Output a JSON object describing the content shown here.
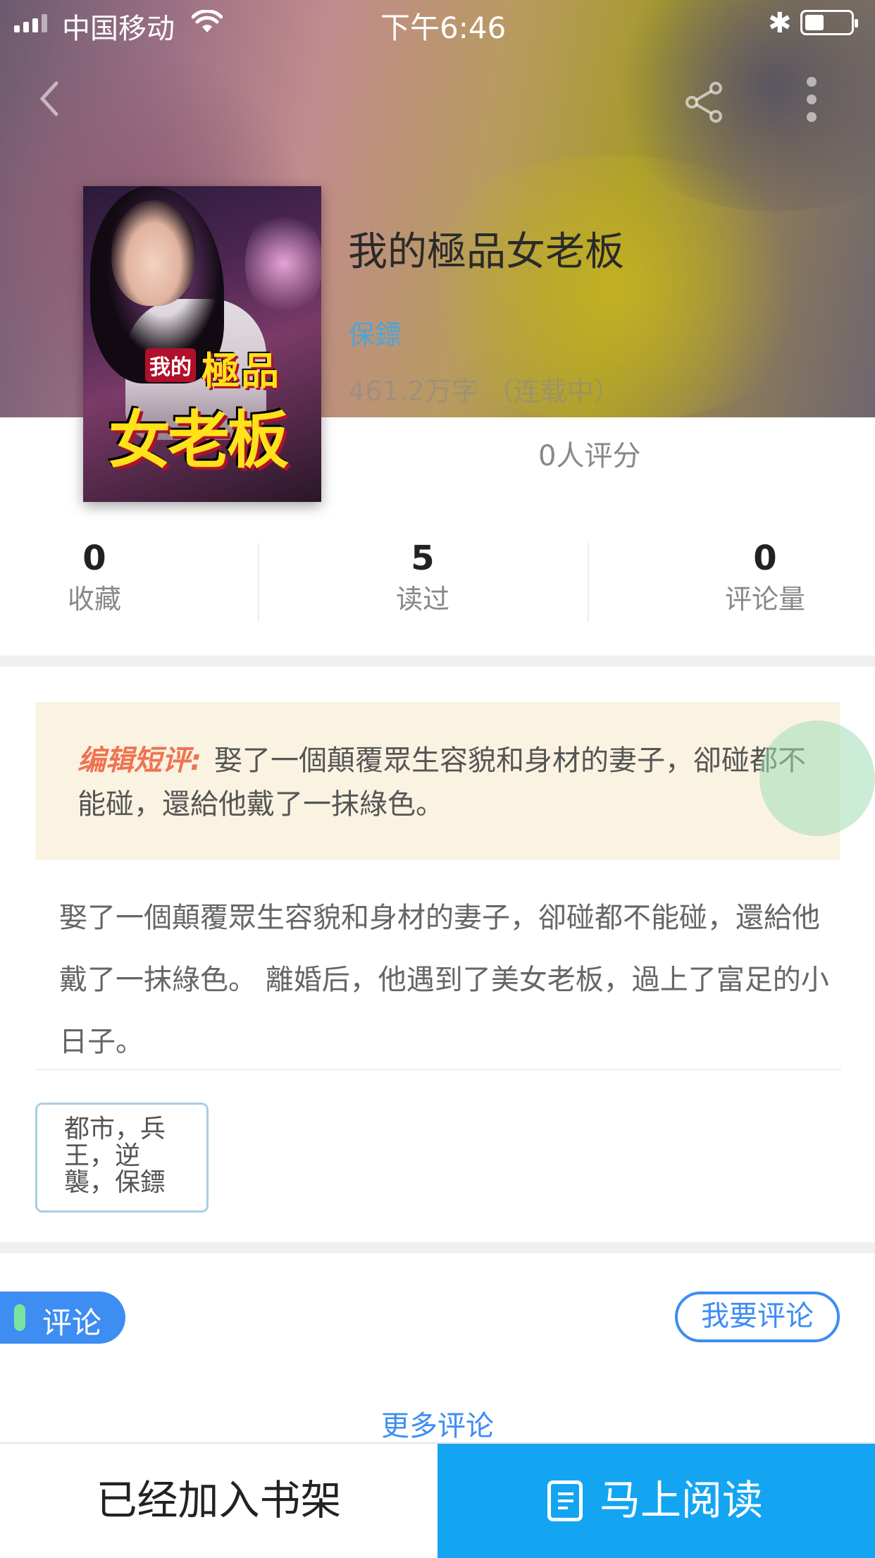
{
  "status_bar": {
    "carrier": "中国移动",
    "time": "下午6:46"
  },
  "book": {
    "title": "我的極品女老板",
    "author": "保鏢",
    "meta": "461.2万字 （连载中）",
    "rating_text": "0人评分",
    "cover": {
      "text_small": "我的",
      "text_mid": "極品",
      "text_big": "女老板"
    }
  },
  "stats": [
    {
      "value": "0",
      "label": "收藏"
    },
    {
      "value": "5",
      "label": "读过"
    },
    {
      "value": "0",
      "label": "评论量"
    }
  ],
  "editor_review": {
    "label": "编辑短评:",
    "text": "娶了一個顛覆眾生容貌和身材的妻子，卻碰都不能碰，還給他戴了一抹綠色。"
  },
  "description": "娶了一個顛覆眾生容貌和身材的妻子，卻碰都不能碰，還給他戴了一抹綠色。 離婚后，他遇到了美女老板，過上了富足的小日子。",
  "tags": "都市，兵王，逆襲，保鏢",
  "comments": {
    "tab_label": "评论",
    "write_button": "我要评论",
    "more_link": "更多评论"
  },
  "bottom_bar": {
    "shelf_label": "已经加入书架",
    "read_label": "马上阅读"
  },
  "colors": {
    "accent_blue": "#3d8df2",
    "read_button": "#13a5f2",
    "review_label": "#ee7452",
    "review_bg": "#fbf3e2"
  }
}
